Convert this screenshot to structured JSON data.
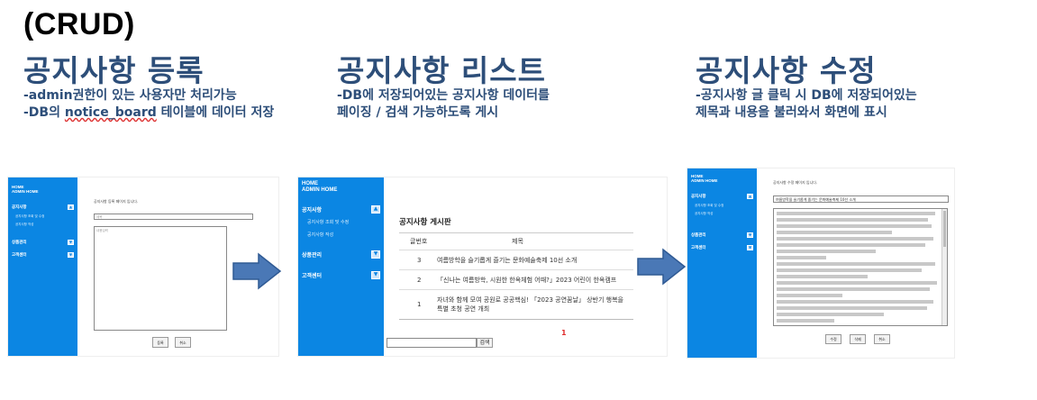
{
  "header": {
    "crud": "(CRUD)"
  },
  "sections": [
    {
      "title": "공지사항 등록",
      "desc_line1": "-admin권한이 있는 사용자만 처리가능",
      "desc_line2_a": "-DB의 ",
      "desc_line2_b": "notice_board",
      "desc_line2_c": " 테이블에 데이터 저장"
    },
    {
      "title": "공지사항 리스트",
      "desc_line1": "-DB에 저장되어있는 공지사항 데이터를",
      "desc_line2": "페이징 / 검색 가능하도록 게시"
    },
    {
      "title": "공지사항 수정",
      "desc_line1": "-공지사항 글 클릭 시 DB에 저장되어있는",
      "desc_line2": "제목과 내용을 불러와서 화면에 표시"
    }
  ],
  "shot1": {
    "sidebar": {
      "home": "HOME",
      "admin_home": "ADMIN HOME",
      "menu1": "공지사항",
      "sub1": "공지사항 조회 및 수정",
      "sub2": "공지사항 작성",
      "menu2": "상품관리",
      "menu3": "고객센터"
    },
    "heading": "공지사항 등록 페이지 입니다.",
    "title_placeholder": "제목",
    "content_placeholder": "내용입력",
    "btn_register": "등록",
    "btn_cancel": "취소"
  },
  "shot2": {
    "sidebar": {
      "home": "HOME",
      "admin_home": "ADMIN HOME",
      "menu1": "공지사항",
      "sub1": "공지사항 조회 및 수정",
      "sub2": "공지사항 작성",
      "menu2": "상품관리",
      "menu3": "고객센터"
    },
    "board_title": "공지사항 게시판",
    "col_no": "글번호",
    "col_title": "제목",
    "rows": [
      {
        "no": "3",
        "title": "여름방학을 슬기롭게 즐기는 문화예술축제 10선 소개"
      },
      {
        "no": "2",
        "title": "「신나는 여름방학, 시원한 한옥체험 어때?」2023 어린이 한옥캠프"
      },
      {
        "no": "1",
        "title": "자녀와 함께 모여 공원로 공공핵심! 「2023 공연꿈날」 상반기 행복을 특별 초청 공연 개최"
      }
    ],
    "page": "1",
    "search_btn": "검색"
  },
  "shot3": {
    "sidebar": {
      "home": "HOME",
      "admin_home": "ADMIN HOME",
      "menu1": "공지사항",
      "sub1": "공지사항 조회 및 수정",
      "sub2": "공지사항 작성",
      "menu2": "상품관리",
      "menu3": "고객센터"
    },
    "heading": "공지사항 수정 페이지 입니다.",
    "title_value": "여름방학을 슬기롭게 즐기는 문화예술축제 10선 소개",
    "btn_edit": "수정",
    "btn_delete": "삭제",
    "btn_cancel": "취소"
  }
}
